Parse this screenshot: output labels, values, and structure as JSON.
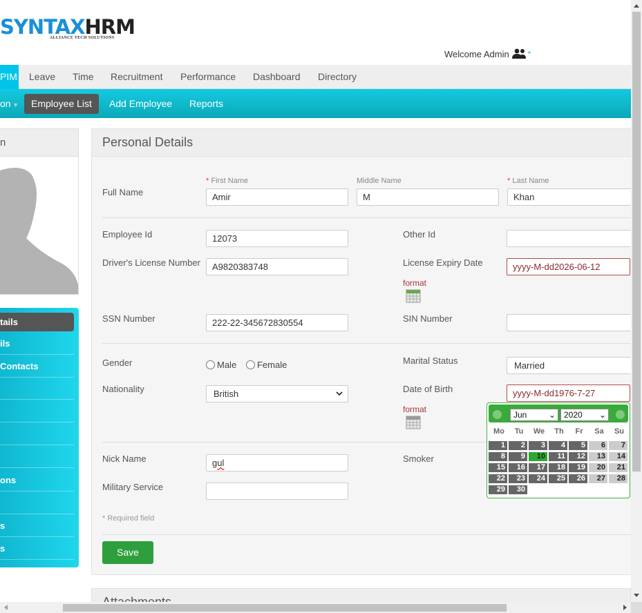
{
  "header": {
    "logo_part1": "SYNTAX",
    "logo_part2": "HRM",
    "logo_sub": "ALLIANCE TECH SOLUTIONS",
    "welcome": "Welcome Admin"
  },
  "main_menu": [
    "PIM",
    "Leave",
    "Time",
    "Recruitment",
    "Performance",
    "Dashboard",
    "Directory"
  ],
  "sub_menu": [
    "on",
    "Employee List",
    "Add Employee",
    "Reports"
  ],
  "profile": {
    "name_fragment": "n"
  },
  "side_nav": [
    "tails",
    "ils",
    "Contacts",
    "",
    "",
    "",
    "",
    "ons",
    "",
    "s",
    "s"
  ],
  "personal_details": {
    "title": "Personal Details",
    "full_name_label": "Full Name",
    "first_name_label": "First Name",
    "middle_name_label": "Middle Name",
    "last_name_label": "Last Name",
    "first_name": "Amir",
    "middle_name": "M",
    "last_name": "Khan",
    "employee_id_label": "Employee Id",
    "employee_id": "12073",
    "other_id_label": "Other Id",
    "other_id": "",
    "license_label": "Driver's License Number",
    "license": "A9820383748",
    "license_expiry_label": "License Expiry Date",
    "license_expiry": "yyyy-M-dd2026-06-12",
    "format_label": "format",
    "ssn_label": "SSN Number",
    "ssn": "222-22-345672830554",
    "sin_label": "SIN Number",
    "sin": "",
    "gender_label": "Gender",
    "male": "Male",
    "female": "Female",
    "marital_label": "Marital Status",
    "marital": "Married",
    "nationality_label": "Nationality",
    "nationality": "British",
    "dob_label": "Date of Birth",
    "dob": "yyyy-M-dd1976-7-27",
    "nick_label": "Nick Name",
    "nick": "gul",
    "smoker_label": "Smoker",
    "military_label": "Military Service",
    "military": "",
    "required_note": "* Required field",
    "save": "Save"
  },
  "datepicker": {
    "month": "Jun",
    "year": "2020",
    "dow": [
      "Mo",
      "Tu",
      "We",
      "Th",
      "Fr",
      "Sa",
      "Su"
    ],
    "today": 10,
    "weeks": [
      [
        "1",
        "2",
        "3",
        "4",
        "5",
        "6",
        "7"
      ],
      [
        "8",
        "9",
        "10",
        "11",
        "12",
        "13",
        "14"
      ],
      [
        "15",
        "16",
        "17",
        "18",
        "19",
        "20",
        "21"
      ],
      [
        "22",
        "23",
        "24",
        "25",
        "26",
        "27",
        "28"
      ],
      [
        "29",
        "30"
      ]
    ]
  },
  "attachments_title": "Attachments",
  "colors": {
    "accent": "#00c4ea",
    "save": "#2e9f3c",
    "calendar": "#3aaa3a"
  }
}
